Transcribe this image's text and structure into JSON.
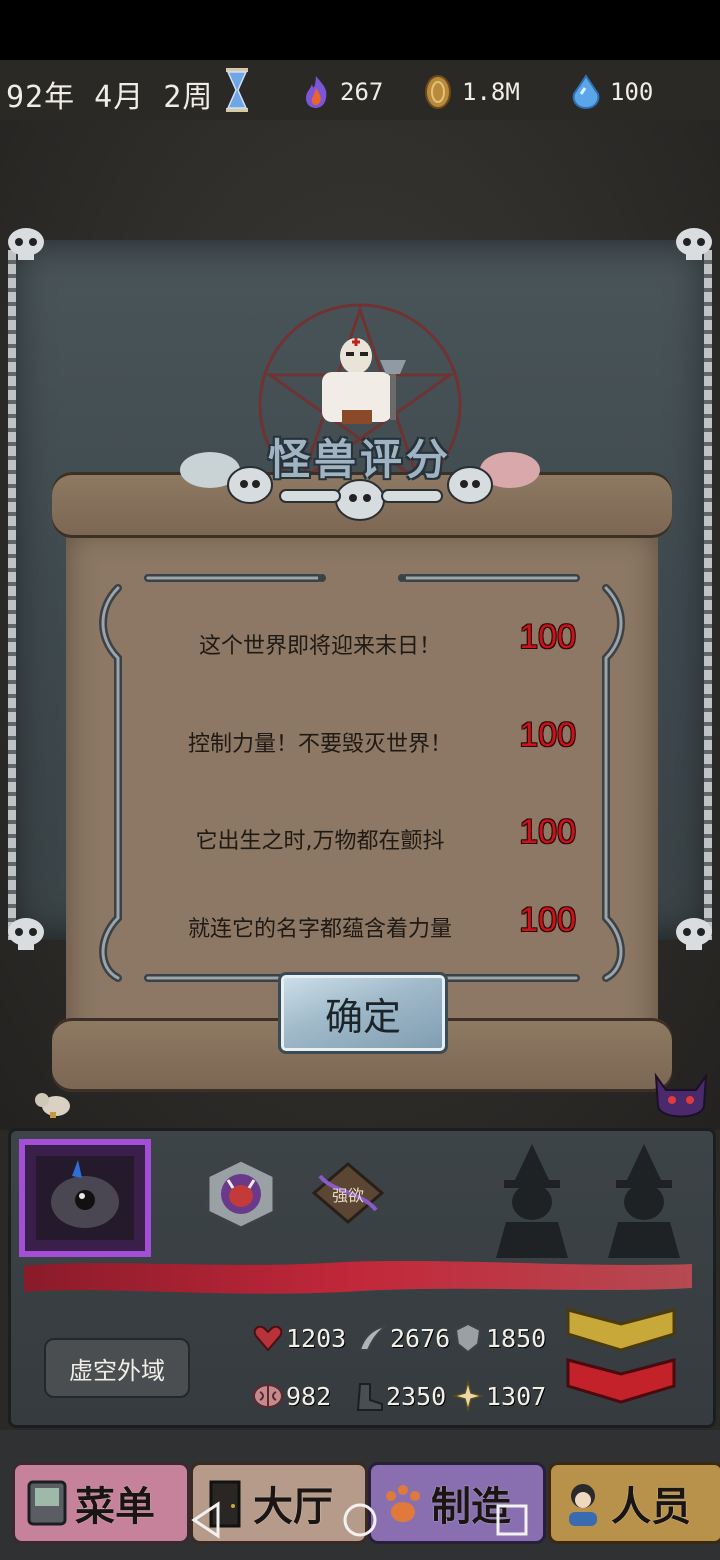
{
  "hud": {
    "date": "92年 4月 2周",
    "fire_value": "267",
    "coin_value": "1.8M",
    "water_value": "100"
  },
  "dialog": {
    "title": "怪兽评分",
    "rows": [
      {
        "text": "这个世界即将迎来末日！",
        "score": "100"
      },
      {
        "text": "控制力量！不要毁灭世界！",
        "score": "100"
      },
      {
        "text": "它出生之时,万物都在颤抖",
        "score": "100"
      },
      {
        "text": "就连它的名字都蕴含着力量",
        "score": "100"
      }
    ],
    "confirm_label": "确定"
  },
  "monster_panel": {
    "trait_label": "强欲",
    "area_label": "虚空外域",
    "stats": {
      "hp": "1203",
      "attack": "2676",
      "defense": "1850",
      "intelligence": "982",
      "speed": "2350",
      "magic": "1307"
    }
  },
  "nav": {
    "tabs": [
      {
        "label": "菜单",
        "icon": "device-icon"
      },
      {
        "label": "大厅",
        "icon": "door-icon"
      },
      {
        "label": "制造",
        "icon": "paw-icon"
      },
      {
        "label": "人员",
        "icon": "person-icon"
      }
    ]
  },
  "colors": {
    "score_red": "#c8141a",
    "title_blue": "#9fb3c2",
    "parchment": "#8c7864",
    "tab_menu": "#c5829a",
    "tab_hall": "#b69a8a",
    "tab_craft": "#8a6fb0",
    "tab_staff": "#b8924a"
  }
}
